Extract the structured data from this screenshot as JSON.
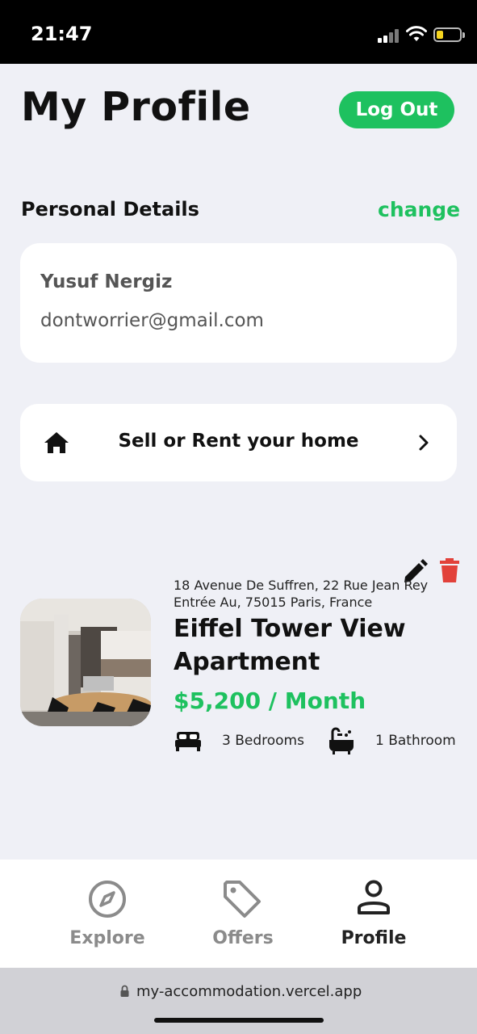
{
  "status_bar": {
    "time": "21:47"
  },
  "header": {
    "title": "My Profile",
    "logout_label": "Log Out"
  },
  "personal_details": {
    "section_title": "Personal Details",
    "change_label": "change",
    "name": "Yusuf Nergiz",
    "email": "dontworrier@gmail.com"
  },
  "sell_card": {
    "label": "Sell or Rent your home"
  },
  "listing": {
    "address": "18 Avenue De Suffren, 22 Rue Jean Rey Entrée Au, 75015 Paris, France",
    "title": "Eiffel Tower View Apartment",
    "price": "$5,200 / Month",
    "bedrooms": "3 Bedrooms",
    "bathrooms": "1 Bathroom"
  },
  "nav": {
    "items": [
      {
        "label": "Explore",
        "icon": "compass-icon"
      },
      {
        "label": "Offers",
        "icon": "tag-icon"
      },
      {
        "label": "Profile",
        "icon": "person-icon"
      }
    ],
    "active": "Profile"
  },
  "browser": {
    "url": "my-accommodation.vercel.app"
  },
  "colors": {
    "accent": "#1ec15f",
    "delete": "#e2413a",
    "background": "#eff0f6"
  }
}
